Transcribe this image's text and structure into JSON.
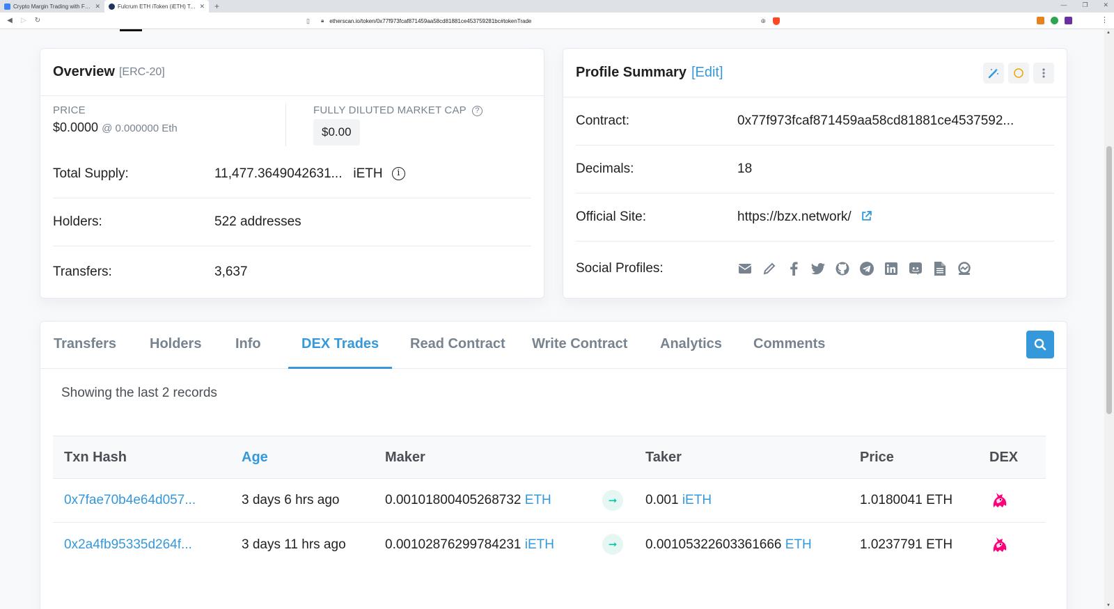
{
  "browser": {
    "tabs": [
      {
        "title": "Crypto Margin Trading with Fulcru",
        "fav": "#3b82f6"
      },
      {
        "title": "Fulcrum ETH iToken (iETH) Token T",
        "fav": "#21325b"
      }
    ],
    "url": "etherscan.io/token/0x77f973fcaf871459aa58cd81881ce453759281bc#tokenTrade"
  },
  "overview": {
    "title": "Overview",
    "standard": "[ERC-20]",
    "price_label": "PRICE",
    "price": "$0.0000",
    "price_eth": "@ 0.000000 Eth",
    "mcap_label": "FULLY DILUTED MARKET CAP",
    "mcap": "$0.00",
    "total_supply_label": "Total Supply:",
    "total_supply": "11,477.3649042631...",
    "total_supply_symbol": "iETH",
    "holders_label": "Holders:",
    "holders": "522 addresses",
    "transfers_label": "Transfers:",
    "transfers": "3,637"
  },
  "profile": {
    "title": "Profile Summary",
    "edit": "[Edit]",
    "contract_label": "Contract:",
    "contract": "0x77f973fcaf871459aa58cd81881ce4537592...",
    "decimals_label": "Decimals:",
    "decimals": "18",
    "site_label": "Official Site:",
    "site": "https://bzx.network/",
    "social_label": "Social Profiles:",
    "social_icons": [
      "email-icon",
      "pencil-icon",
      "facebook-icon",
      "twitter-icon",
      "github-icon",
      "telegram-icon",
      "linkedin-icon",
      "discord-icon",
      "document-icon",
      "coinmarketcap-icon"
    ]
  },
  "tabs": {
    "items": [
      "Transfers",
      "Holders",
      "Info",
      "DEX Trades",
      "Read Contract",
      "Write Contract",
      "Analytics",
      "Comments"
    ],
    "active": "DEX Trades"
  },
  "trades": {
    "records": "Showing the last 2 records",
    "headers": {
      "hash": "Txn Hash",
      "age": "Age",
      "maker": "Maker",
      "taker": "Taker",
      "price": "Price",
      "dex": "DEX"
    },
    "rows": [
      {
        "hash": "0x7fae70b4e64d057...",
        "age": "3 days 6 hrs ago",
        "maker_amt": "0.00101800405268732",
        "maker_sym": "ETH",
        "taker_amt": "0.001",
        "taker_sym": "iETH",
        "price": "1.0180041 ETH"
      },
      {
        "hash": "0x2a4fb95335d264f...",
        "age": "3 days 11 hrs ago",
        "maker_amt": "0.00102876299784231",
        "maker_sym": "iETH",
        "taker_amt": "0.00105322603361666",
        "taker_sym": "ETH",
        "price": "1.0237791 ETH"
      }
    ]
  },
  "colors": {
    "accent": "#3498db",
    "arrow": "#00c9a7"
  }
}
